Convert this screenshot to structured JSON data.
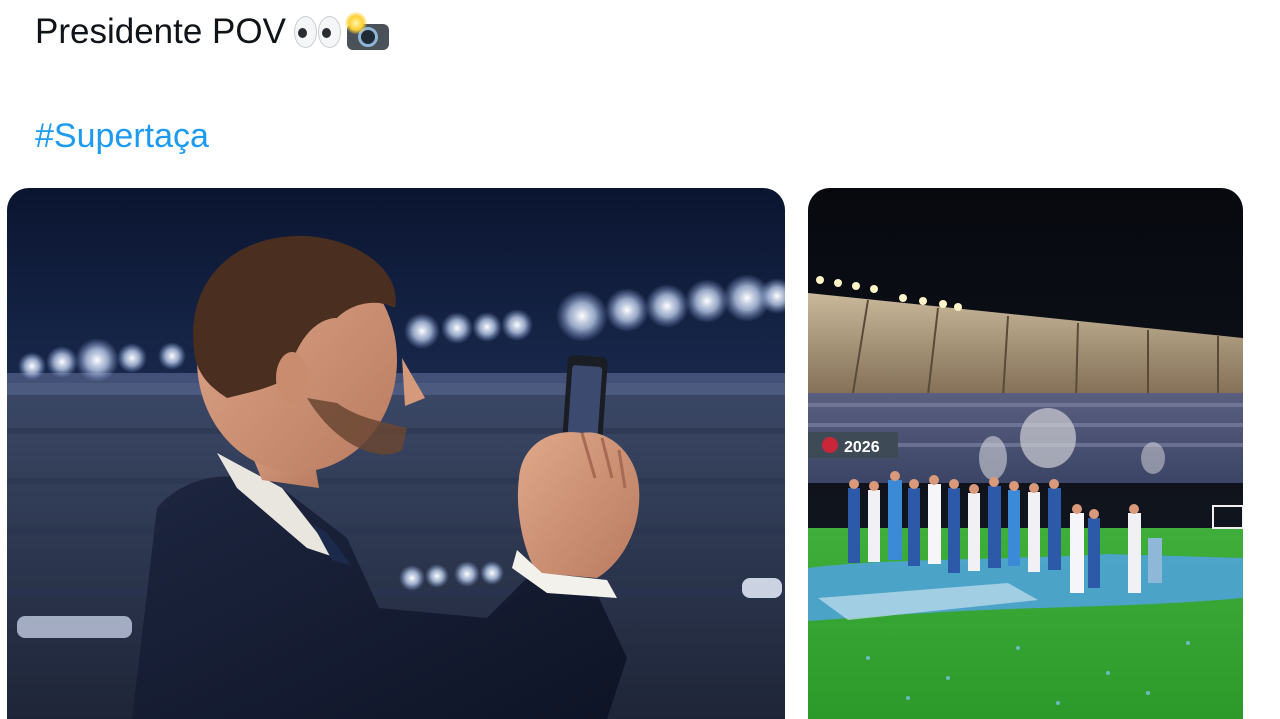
{
  "tweet": {
    "text": "Presidente POV",
    "emojis": [
      "eyes-icon",
      "camera-flash-icon"
    ],
    "hashtag": "#Supertaça"
  },
  "media": [
    {
      "name": "photo-president-filming"
    },
    {
      "name": "photo-stadium-celebration",
      "board_text": "2026"
    }
  ],
  "colors": {
    "link": "#1d9bf0",
    "text": "#0f1419"
  }
}
